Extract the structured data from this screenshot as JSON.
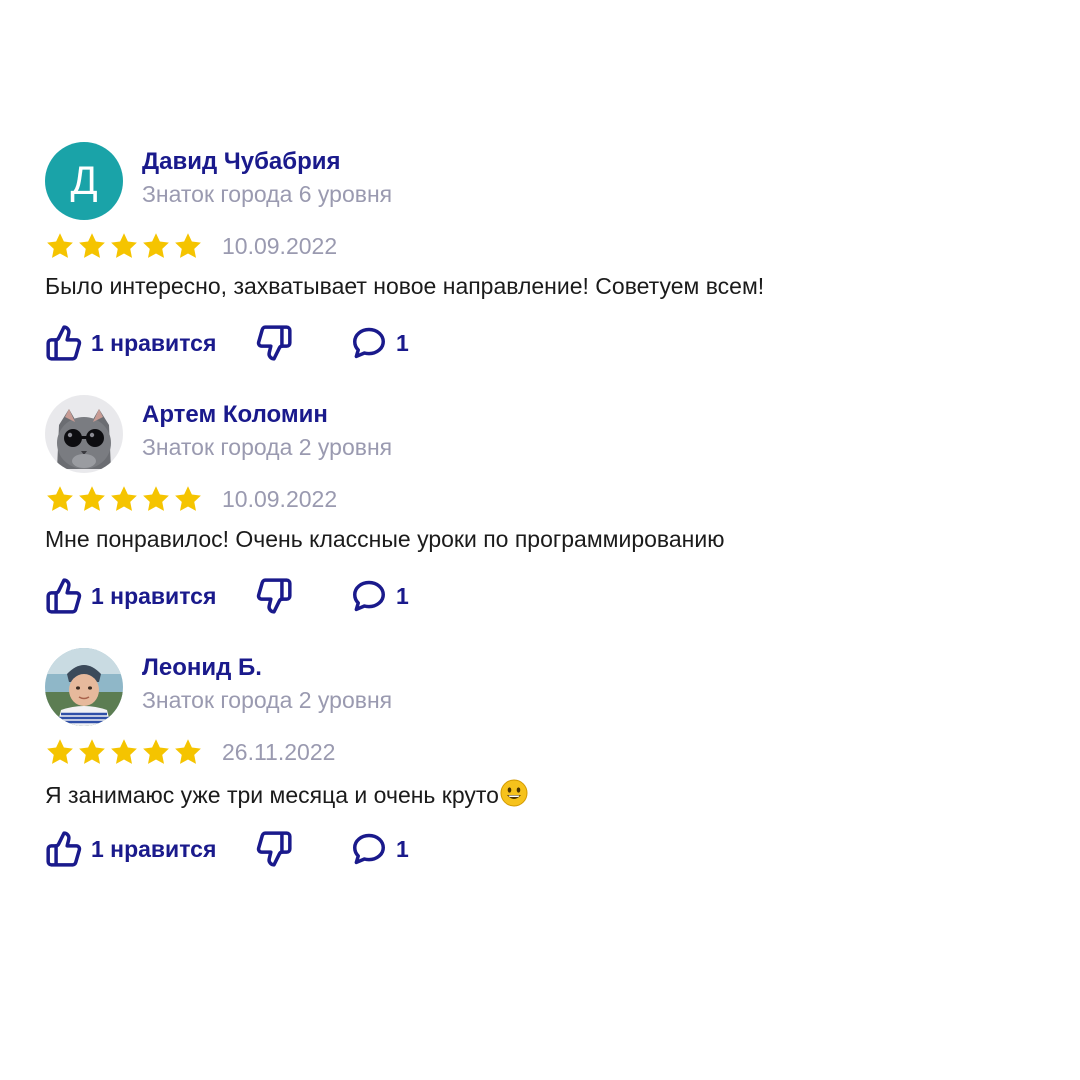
{
  "reviews": [
    {
      "avatar": {
        "type": "letter",
        "letter": "Д",
        "color": "#1aa3a8"
      },
      "author": "Давид Чубабрия",
      "level": "Знаток города 6 уровня",
      "rating": 5,
      "date": "10.09.2022",
      "text": "Было интересно, захватывает новое направление! Советуем всем!",
      "likes_label": "1 нравится",
      "comments_count": "1"
    },
    {
      "avatar": {
        "type": "photo",
        "subject": "cat-with-sunglasses"
      },
      "author": "Артем Коломин",
      "level": "Знаток города 2 уровня",
      "rating": 5,
      "date": "10.09.2022",
      "text": "Мне понравилос! Очень классные уроки по программированию",
      "likes_label": "1 нравится",
      "comments_count": "1"
    },
    {
      "avatar": {
        "type": "photo",
        "subject": "child-portrait"
      },
      "author": "Леонид Б.",
      "level": "Знаток города 2 уровня",
      "rating": 5,
      "date": "26.11.2022",
      "text": "Я занимаюс уже три месяца и очень круто",
      "text_emoji": "grinning-face-emoji",
      "likes_label": "1 нравится",
      "comments_count": "1"
    }
  ],
  "colors": {
    "author": "#1a1a8c",
    "muted": "#9a9ab0",
    "star": "#f5c400",
    "action": "#1a1a8c",
    "text": "#1b1b1b"
  },
  "icons": {
    "like": "thumbs-up-icon",
    "dislike": "thumbs-down-icon",
    "comment": "comment-bubble-icon",
    "star": "star-icon"
  }
}
